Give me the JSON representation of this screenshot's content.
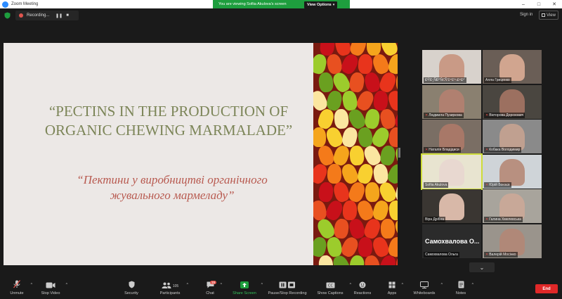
{
  "window": {
    "title": "Zoom Meeting"
  },
  "banner": {
    "message": "You are viewing Sofiia Akulova's screen",
    "options_label": "View Options"
  },
  "recording": {
    "label": "Recording..."
  },
  "header": {
    "signin_label": "Sign in",
    "view_label": "View"
  },
  "slide": {
    "title": "“PECTINS IN THE PRODUCTION OF ORGANIC CHEWING MARMALADE”",
    "subtitle": "“Пектини у виробництві органічного жувального мармеладу”",
    "colors": {
      "background": "#ece8e6",
      "title": "#7c8558",
      "subtitle": "#b85a50"
    }
  },
  "participants": [
    {
      "name": "ÐŸÐ¸ÑÐ°Ñ€Ñ'ÐºÐ¾Ð²Ð°",
      "muted": false
    },
    {
      "name": "Алла Гриценко",
      "muted": false
    },
    {
      "name": "Людмила Пузиркова",
      "muted": true
    },
    {
      "name": "Вікторова Дорохович",
      "muted": true
    },
    {
      "name": "Наталія Владідиси",
      "muted": true
    },
    {
      "name": "Кобака Володимир",
      "muted": true
    },
    {
      "name": "Sofiia Akulova",
      "muted": false
    },
    {
      "name": "Юрій Бокаєв",
      "muted": true
    },
    {
      "name": "Віра Дрібна",
      "muted": false
    },
    {
      "name": "Галина Хмелевська",
      "muted": true
    },
    {
      "name": "Самохвалова Ольга",
      "muted": false,
      "display_name": "Самохвалова О..."
    },
    {
      "name": "Валерій Мосінко",
      "muted": true
    }
  ],
  "toolbar": {
    "unmute": "Unmute",
    "stop_video": "Stop Video",
    "security": "Security",
    "participants": "Participants",
    "participants_count": "105",
    "chat": "Chat",
    "chat_badge": "19",
    "share_screen": "Share Screen",
    "pause_recording": "Pause/Stop Recording",
    "show_captions": "Show Captions",
    "reactions": "Reactions",
    "apps": "Apps",
    "whiteboards": "Whiteboards",
    "notes": "Notes",
    "end": "End"
  },
  "colors": {
    "accent": "#2d8cff",
    "share_green": "#1e9e3e",
    "end_red": "#e02828",
    "active_speaker": "#cddc39"
  }
}
